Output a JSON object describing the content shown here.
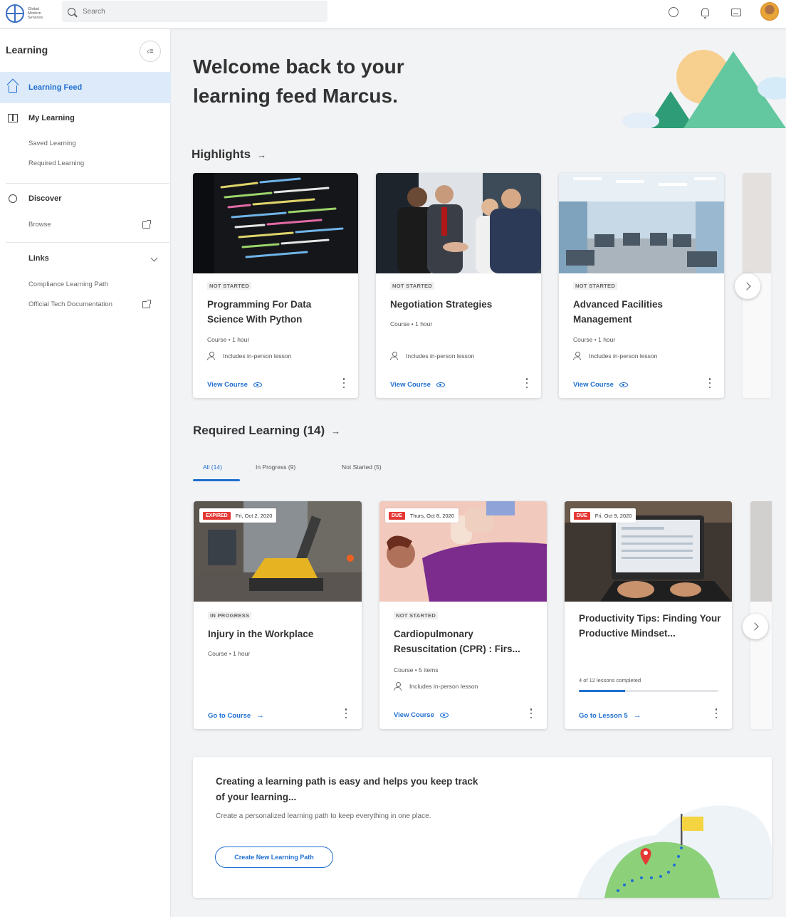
{
  "brand": {
    "name": "Global Modern Services"
  },
  "search": {
    "placeholder": "Search"
  },
  "colors": {
    "accent": "#1f6fd0",
    "due": "#e53935",
    "active_bg": "#ddeaf9"
  },
  "sidebar": {
    "title": "Learning",
    "nav": [
      {
        "label": "Learning Feed",
        "icon": "home-icon",
        "active": true
      },
      {
        "label": "My Learning",
        "icon": "book-icon"
      },
      {
        "label": "Discover",
        "icon": "search-icon"
      }
    ],
    "my_learning_sub": [
      "Saved Learning",
      "Required Learning"
    ],
    "discover_sub": [
      "Browse"
    ],
    "links": {
      "label": "Links",
      "items": [
        "Compliance Learning Path",
        "Official Tech Documentation"
      ]
    }
  },
  "welcome": "Welcome back to your learning feed Marcus.",
  "highlights": {
    "title": "Highlights",
    "cards": [
      {
        "status": "NOT STARTED",
        "title": "Programming For Data Science With Python",
        "meta": "Course • 1 hour",
        "person": "Includes in-person lesson",
        "link": "View Course",
        "image": "code-screen"
      },
      {
        "status": "NOT STARTED",
        "title": "Negotiation Strategies",
        "meta": "Course • 1 hour",
        "person": "Includes in-person lesson",
        "link": "View Course",
        "image": "handshake"
      },
      {
        "status": "NOT STARTED",
        "title": "Advanced Facilities Management",
        "meta": "Course • 1 hour",
        "person": "Includes in-person lesson",
        "link": "View Course",
        "image": "office"
      }
    ]
  },
  "required": {
    "title": "Required Learning (14)",
    "tabs": [
      "All (14)",
      "In Progress (9)",
      "Not Started (5)"
    ],
    "cards": [
      {
        "badge": "EXPIRED",
        "date": "Fri, Oct 2, 2020",
        "status": "IN PROGRESS",
        "title": "Injury in the Workplace",
        "meta": "Course • 1 hour",
        "link": "Go to Course",
        "image": "construction"
      },
      {
        "badge": "DUE",
        "date": "Thurs, Oct 8, 2020",
        "status": "NOT STARTED",
        "title": "Cardiopulmonary Resuscitation (CPR) : Firs...",
        "meta": "Course • 5 items",
        "person": "Includes in-person lesson",
        "link": "View Course",
        "image": "cpr"
      },
      {
        "badge": "DUE",
        "date": "Fri, Oct 9, 2020",
        "title": "Productivity Tips: Finding Your Productive Mindset...",
        "progress_text": "4 of 12 lessons completed",
        "progress": 0.333,
        "link": "Go to Lesson 5",
        "image": "laptop"
      }
    ]
  },
  "cta": {
    "title": "Creating a learning path is easy and helps you keep track of your learning...",
    "desc": "Create a personalized learning path to keep everything in one place.",
    "button": "Create New Learning Path"
  }
}
